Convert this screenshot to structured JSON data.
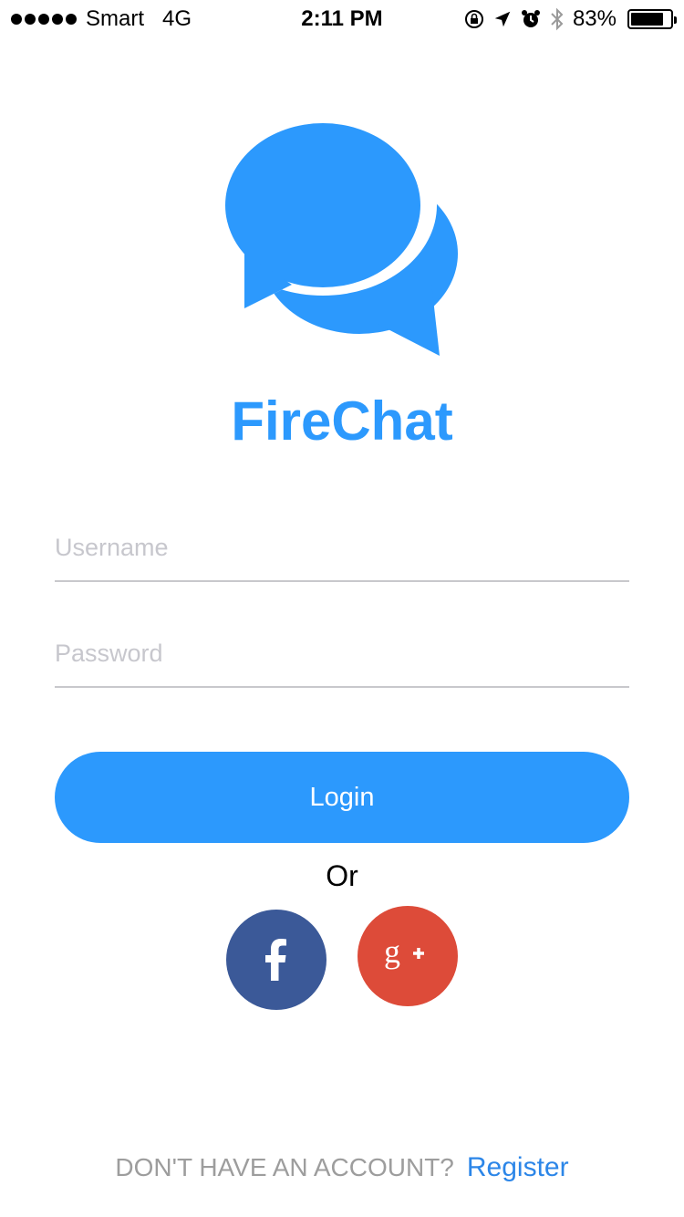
{
  "status_bar": {
    "carrier": "Smart",
    "network": "4G",
    "time": "2:11 PM",
    "battery": "83%",
    "battery_level": 0.83
  },
  "app": {
    "title": "FireChat",
    "logo_icon": "chat-bubbles-icon",
    "accent_color": "#2c99fd"
  },
  "form": {
    "username_placeholder": "Username",
    "username_value": "",
    "password_placeholder": "Password",
    "password_value": "",
    "login_label": "Login",
    "or_label": "Or"
  },
  "social": {
    "facebook_icon": "facebook-icon",
    "facebook_color": "#3b5998",
    "google_icon": "google-plus-icon",
    "google_color": "#dd4b39"
  },
  "footer": {
    "prompt": "DON'T HAVE AN ACCOUNT?",
    "register_label": "Register"
  }
}
